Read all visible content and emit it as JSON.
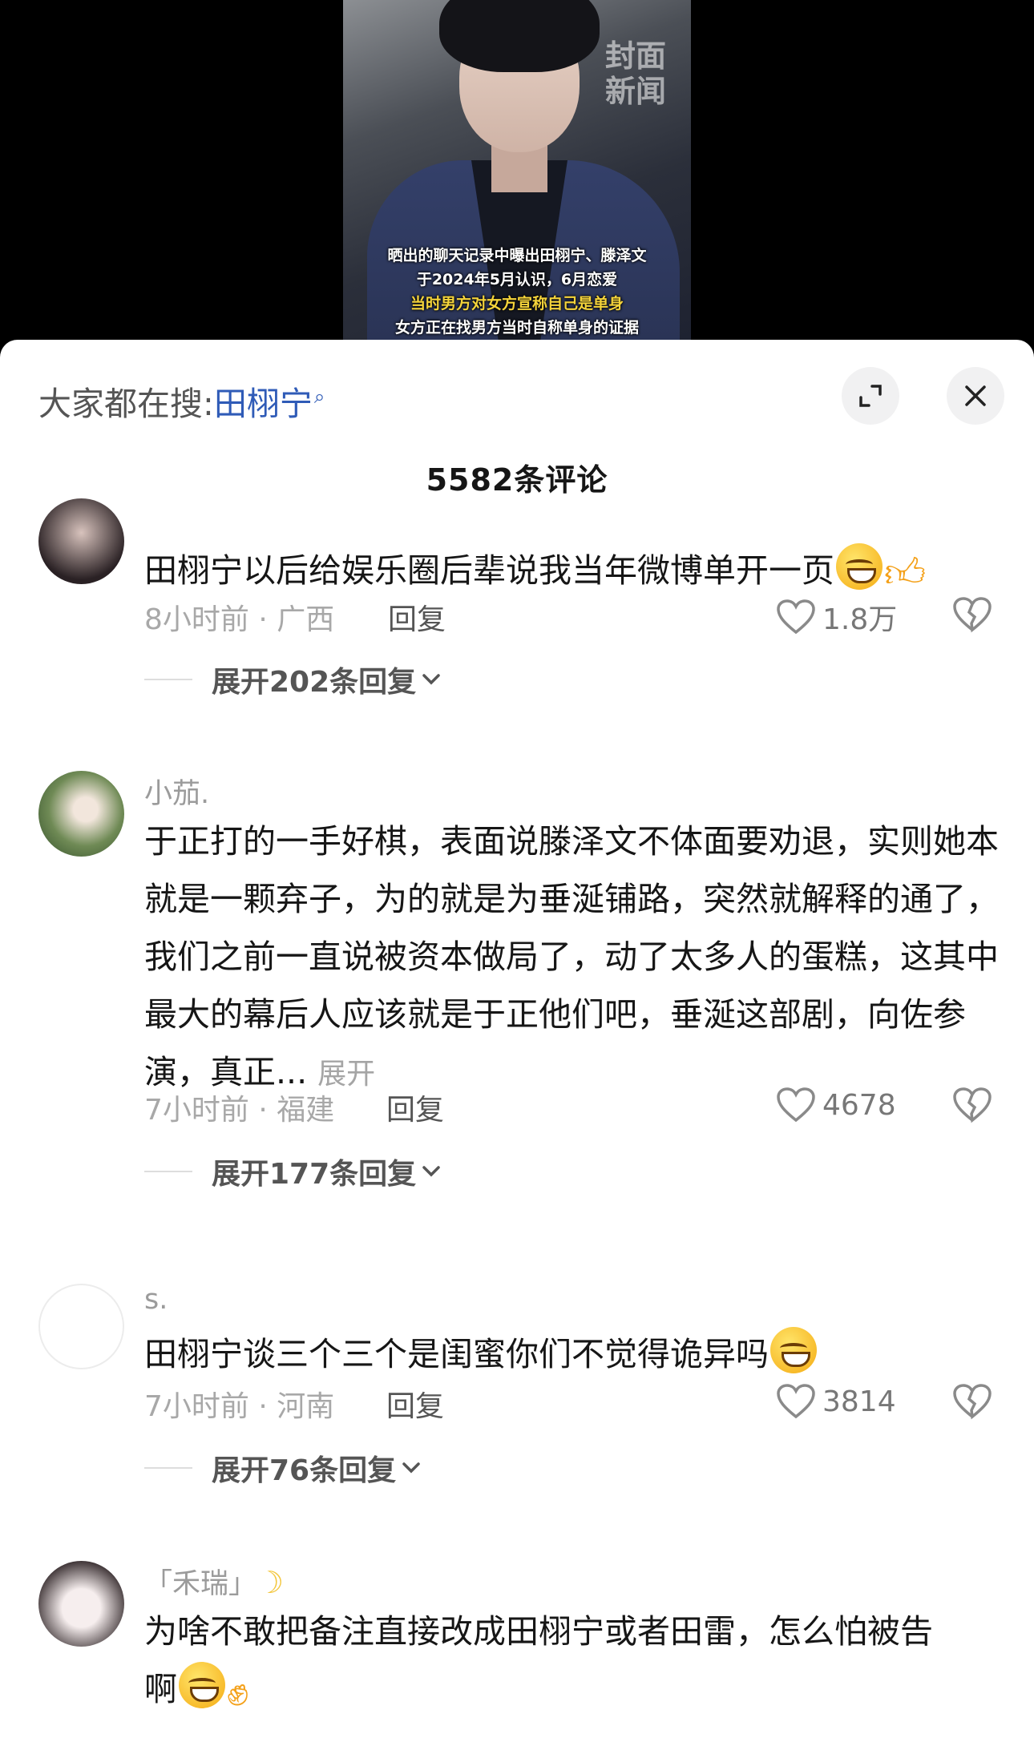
{
  "video": {
    "watermark_line1": "封面",
    "watermark_line2": "新闻",
    "caption_lines": [
      "晒出的聊天记录中曝出田栩宁、滕泽文",
      "于2024年5月认识，6月恋爱",
      "当时男方对女方宣称自己是单身",
      "女方正在找男方当时自称单身的证据"
    ]
  },
  "sheet": {
    "search_prefix": "大家都在搜:",
    "search_term": "田栩宁",
    "comment_count": "5582条评论"
  },
  "comments": [
    {
      "username": "",
      "text": "田栩宁以后给娱乐圈后辈说我当年微博单开一页",
      "time_location": "8小时前 · 广西",
      "reply_label": "回复",
      "likes": "1.8万",
      "expand_replies": "展开202条回复"
    },
    {
      "username": "小茄.",
      "text": "于正打的一手好棋，表面说滕泽文不体面要劝退，实则她本就是一颗弃子，为的就是为垂涎铺路，突然就解释的通了，我们之前一直说被资本做局了，动了太多人的蛋糕，这其中最大的幕后人应该就是于正他们吧，垂涎这部剧，向佐参演，真正...",
      "more_label": "展开",
      "time_location": "7小时前 · 福建",
      "reply_label": "回复",
      "likes": "4678",
      "expand_replies": "展开177条回复"
    },
    {
      "username": "s.",
      "text": "田栩宁谈三个三个是闺蜜你们不觉得诡异吗",
      "time_location": "7小时前 · 河南",
      "reply_label": "回复",
      "likes": "3814",
      "expand_replies": "展开76条回复"
    },
    {
      "username": "「禾瑞」",
      "text_line1": "为啥不敢把备注直接改成田栩宁或者田雷，怎么怕被告",
      "text_line2": "啊"
    }
  ],
  "colors": {
    "link_blue": "#2f5bb7",
    "caption_yellow": "#f5d43b",
    "muted_gray": "#a8a8a8"
  }
}
